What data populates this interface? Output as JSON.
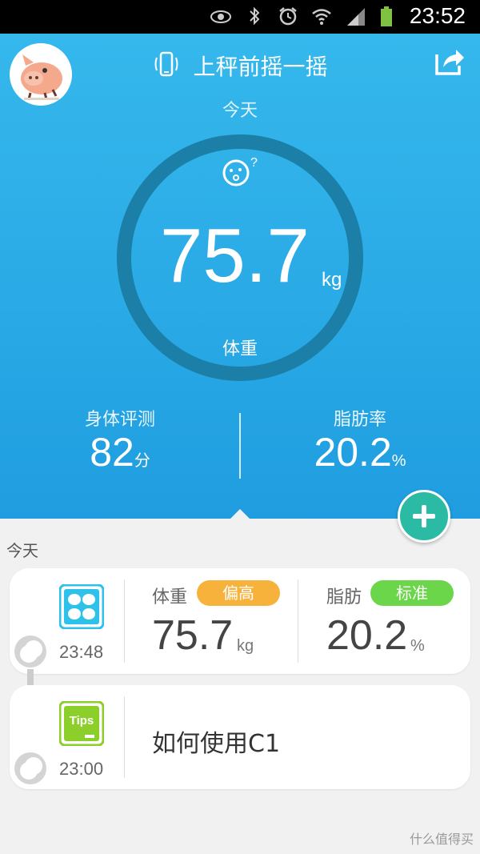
{
  "status_bar": {
    "time": "23:52",
    "icons": [
      "eye-icon",
      "bluetooth-icon",
      "alarm-icon",
      "wifi-icon",
      "signal-icon",
      "battery-icon"
    ]
  },
  "header": {
    "title": "上秤前摇一摇",
    "day": "今天"
  },
  "weight": {
    "value": "75.7",
    "unit": "kg",
    "label": "体重"
  },
  "stats": {
    "body_score": {
      "label": "身体评测",
      "value": "82",
      "unit": "分"
    },
    "fat_rate": {
      "label": "脂肪率",
      "value": "20.2",
      "unit": "%"
    }
  },
  "list": {
    "day": "今天",
    "records": [
      {
        "time": "23:48",
        "weight": {
          "label": "体重",
          "badge": "偏高",
          "value": "75.7",
          "unit": "kg"
        },
        "fat": {
          "label": "脂肪",
          "badge": "标准",
          "value": "20.2",
          "unit": "%"
        }
      },
      {
        "time": "23:00",
        "tile_label": "Tips",
        "title": "如何使用C1"
      }
    ]
  },
  "colors": {
    "hero_top": "#35b8ec",
    "ring": "#1b7fa8",
    "badge_high": "#f7b23b",
    "badge_normal": "#6cd64a",
    "add_button": "#2bbba4",
    "tile_scale": "#2ec2ea",
    "tile_tips": "#8ccf2a"
  },
  "watermark": "什么值得买"
}
